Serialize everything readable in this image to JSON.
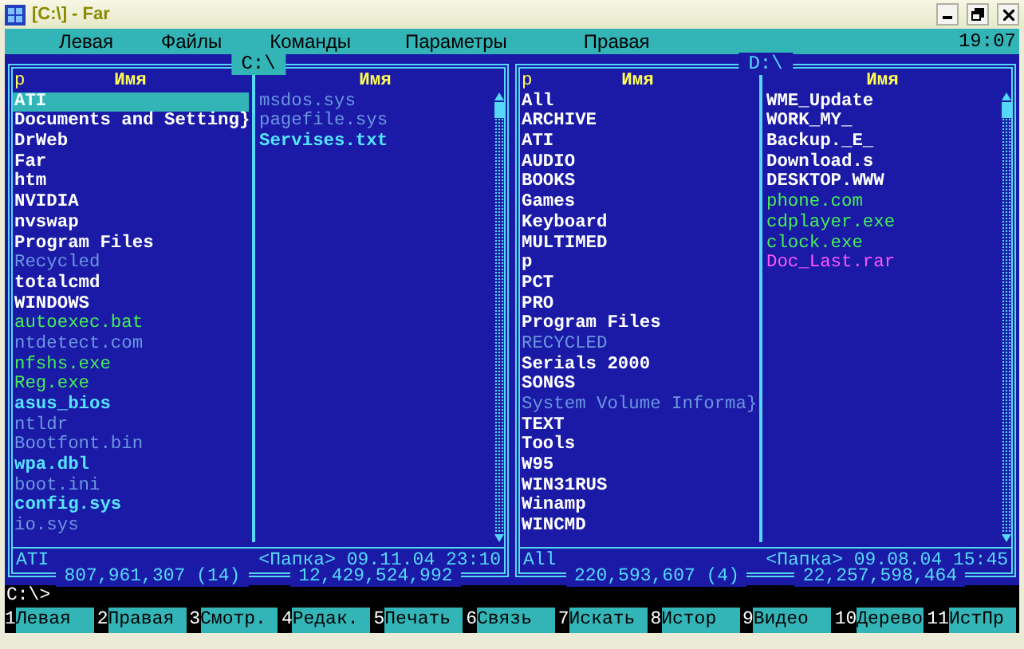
{
  "window": {
    "title": "[C:\\] - Far"
  },
  "menu": [
    {
      "label": "Левая"
    },
    {
      "label": "Файлы"
    },
    {
      "label": "Команды"
    },
    {
      "label": "Параметры"
    },
    {
      "label": "Правая"
    }
  ],
  "clock": "19:07",
  "panels": [
    {
      "path": "C:\\",
      "active": true,
      "columns": [
        {
          "sort_mark": "p",
          "header": "Имя",
          "items": [
            {
              "name": "ATI",
              "kind": "dir",
              "selected": true
            },
            {
              "name": "Documents and Setting}",
              "kind": "dir",
              "selected": false
            },
            {
              "name": "DrWeb",
              "kind": "dir",
              "selected": false
            },
            {
              "name": "Far",
              "kind": "dir",
              "selected": false
            },
            {
              "name": "htm",
              "kind": "dir",
              "selected": false
            },
            {
              "name": "NVIDIA",
              "kind": "dir",
              "selected": false
            },
            {
              "name": "nvswap",
              "kind": "dir",
              "selected": false
            },
            {
              "name": "Program Files",
              "kind": "dir",
              "selected": false
            },
            {
              "name": "Recycled",
              "kind": "hidden",
              "selected": false
            },
            {
              "name": "totalcmd",
              "kind": "dir",
              "selected": false
            },
            {
              "name": "WINDOWS",
              "kind": "dir",
              "selected": false
            },
            {
              "name": "autoexec.bat",
              "kind": "program",
              "selected": false
            },
            {
              "name": "ntdetect.com",
              "kind": "hidden",
              "selected": false
            },
            {
              "name": "nfshs.exe",
              "kind": "program",
              "selected": false
            },
            {
              "name": "Reg.exe",
              "kind": "program",
              "selected": false
            },
            {
              "name": "asus_bios",
              "kind": "file",
              "selected": false
            },
            {
              "name": "ntldr",
              "kind": "hidden",
              "selected": false
            },
            {
              "name": "Bootfont.bin",
              "kind": "hidden",
              "selected": false
            },
            {
              "name": "wpa.dbl",
              "kind": "file",
              "selected": false
            },
            {
              "name": "boot.ini",
              "kind": "hidden",
              "selected": false
            },
            {
              "name": "config.sys",
              "kind": "file",
              "selected": false
            },
            {
              "name": "io.sys",
              "kind": "hidden",
              "selected": false
            }
          ]
        },
        {
          "header": "Имя",
          "items": [
            {
              "name": "msdos.sys",
              "kind": "hidden",
              "selected": false
            },
            {
              "name": "pagefile.sys",
              "kind": "hidden",
              "selected": false
            },
            {
              "name": "Servises.txt",
              "kind": "file",
              "selected": false
            }
          ]
        }
      ],
      "current": {
        "name": "ATI",
        "info": "<Папка> 09.11.04 23:10"
      },
      "totals": {
        "size": "807,961,307 (14)",
        "free": "12,429,524,992"
      }
    },
    {
      "path": "D:\\",
      "active": false,
      "columns": [
        {
          "sort_mark": "p",
          "header": "Имя",
          "items": [
            {
              "name": "All",
              "kind": "dir",
              "selected": false
            },
            {
              "name": "ARCHIVE",
              "kind": "dir",
              "selected": false
            },
            {
              "name": "ATI",
              "kind": "dir",
              "selected": false
            },
            {
              "name": "AUDIO",
              "kind": "dir",
              "selected": false
            },
            {
              "name": "BOOKS",
              "kind": "dir",
              "selected": false
            },
            {
              "name": "Games",
              "kind": "dir",
              "selected": false
            },
            {
              "name": "Keyboard",
              "kind": "dir",
              "selected": false
            },
            {
              "name": "MULTIMED",
              "kind": "dir",
              "selected": false
            },
            {
              "name": "p",
              "kind": "dir",
              "selected": false
            },
            {
              "name": "PCT",
              "kind": "dir",
              "selected": false
            },
            {
              "name": "PRO",
              "kind": "dir",
              "selected": false
            },
            {
              "name": "Program Files",
              "kind": "dir",
              "selected": false
            },
            {
              "name": "RECYCLED",
              "kind": "hidden",
              "selected": false
            },
            {
              "name": "Serials 2000",
              "kind": "dir",
              "selected": false
            },
            {
              "name": "SONGS",
              "kind": "dir",
              "selected": false
            },
            {
              "name": "System Volume Informa}",
              "kind": "hidden",
              "selected": false
            },
            {
              "name": "TEXT",
              "kind": "dir",
              "selected": false
            },
            {
              "name": "Tools",
              "kind": "dir",
              "selected": false
            },
            {
              "name": "W95",
              "kind": "dir",
              "selected": false
            },
            {
              "name": "WIN31RUS",
              "kind": "dir",
              "selected": false
            },
            {
              "name": "Winamp",
              "kind": "dir",
              "selected": false
            },
            {
              "name": "WINCMD",
              "kind": "dir",
              "selected": false
            }
          ]
        },
        {
          "header": "Имя",
          "items": [
            {
              "name": "WME_Update",
              "kind": "dir",
              "selected": false
            },
            {
              "name": "WORK_MY_",
              "kind": "dir",
              "selected": false
            },
            {
              "name": "Backup._E_",
              "kind": "dir",
              "selected": false
            },
            {
              "name": "Download.s",
              "kind": "dir",
              "selected": false
            },
            {
              "name": "DESKTOP.WWW",
              "kind": "dir",
              "selected": false
            },
            {
              "name": "phone.com",
              "kind": "program",
              "selected": false
            },
            {
              "name": "cdplayer.exe",
              "kind": "program",
              "selected": false
            },
            {
              "name": "clock.exe",
              "kind": "program",
              "selected": false
            },
            {
              "name": "Doc_Last.rar",
              "kind": "archive",
              "selected": false
            }
          ]
        }
      ],
      "current": {
        "name": "All",
        "info": "<Папка> 09.08.04 15:45"
      },
      "totals": {
        "size": "220,593,607 (4)",
        "free": "22,257,598,464"
      }
    }
  ],
  "command_line": {
    "prompt": "C:\\>"
  },
  "keybar": [
    {
      "number": "1",
      "label": "Левая"
    },
    {
      "number": "2",
      "label": "Правая"
    },
    {
      "number": "3",
      "label": "Смотр."
    },
    {
      "number": "4",
      "label": "Редак."
    },
    {
      "number": "5",
      "label": "Печать"
    },
    {
      "number": "6",
      "label": "Связь"
    },
    {
      "number": "7",
      "label": "Искать"
    },
    {
      "number": "8",
      "label": "Истор"
    },
    {
      "number": "9",
      "label": "Видео"
    },
    {
      "number": "10",
      "label": "Дерево"
    },
    {
      "number": "11",
      "label": "ИстПр"
    }
  ]
}
